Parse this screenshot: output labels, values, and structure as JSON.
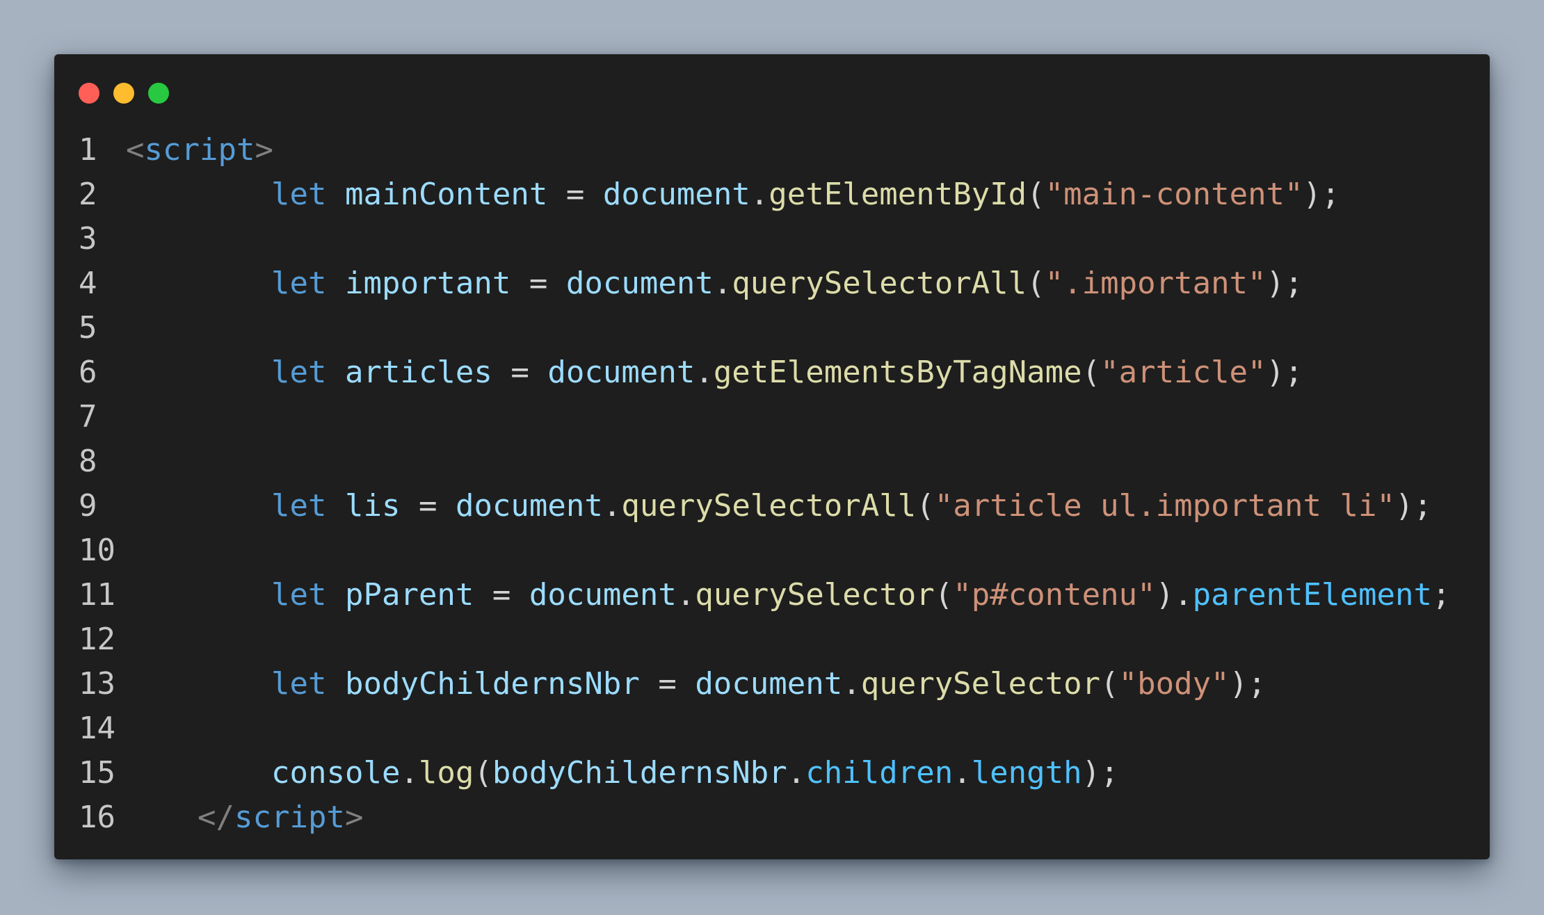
{
  "window_controls": {
    "colors": [
      "#ff5f57",
      "#febc2e",
      "#28c840"
    ],
    "names": [
      "close-window-dot",
      "minimize-window-dot",
      "maximize-window-dot"
    ]
  },
  "code": {
    "lines": [
      {
        "number": "1",
        "indent": 0,
        "tokens": [
          [
            "<",
            "#808080"
          ],
          [
            "script",
            "#569cd6"
          ],
          [
            ">",
            "#808080"
          ]
        ]
      },
      {
        "number": "2",
        "indent": 1,
        "tokens": [
          [
            "let",
            "#569cd6"
          ],
          [
            " ",
            "#d4d4d4"
          ],
          [
            "mainContent",
            "#9cdcfe"
          ],
          [
            " = ",
            "#d4d4d4"
          ],
          [
            "document",
            "#9cdcfe"
          ],
          [
            ".",
            "#d4d4d4"
          ],
          [
            "getElementById",
            "#dcdcaa"
          ],
          [
            "(",
            "#d4d4d4"
          ],
          [
            "\"main-content\"",
            "#ce9178"
          ],
          [
            ");",
            "#d4d4d4"
          ]
        ]
      },
      {
        "number": "3",
        "indent": 0,
        "tokens": []
      },
      {
        "number": "4",
        "indent": 1,
        "tokens": [
          [
            "let",
            "#569cd6"
          ],
          [
            " ",
            "#d4d4d4"
          ],
          [
            "important",
            "#9cdcfe"
          ],
          [
            " = ",
            "#d4d4d4"
          ],
          [
            "document",
            "#9cdcfe"
          ],
          [
            ".",
            "#d4d4d4"
          ],
          [
            "querySelectorAll",
            "#dcdcaa"
          ],
          [
            "(",
            "#d4d4d4"
          ],
          [
            "\".important\"",
            "#ce9178"
          ],
          [
            ");",
            "#d4d4d4"
          ]
        ]
      },
      {
        "number": "5",
        "indent": 0,
        "tokens": []
      },
      {
        "number": "6",
        "indent": 1,
        "tokens": [
          [
            "let",
            "#569cd6"
          ],
          [
            " ",
            "#d4d4d4"
          ],
          [
            "articles",
            "#9cdcfe"
          ],
          [
            " = ",
            "#d4d4d4"
          ],
          [
            "document",
            "#9cdcfe"
          ],
          [
            ".",
            "#d4d4d4"
          ],
          [
            "getElementsByTagName",
            "#dcdcaa"
          ],
          [
            "(",
            "#d4d4d4"
          ],
          [
            "\"article\"",
            "#ce9178"
          ],
          [
            ");",
            "#d4d4d4"
          ]
        ]
      },
      {
        "number": "7",
        "indent": 0,
        "tokens": []
      },
      {
        "number": "8",
        "indent": 0,
        "tokens": []
      },
      {
        "number": "9",
        "indent": 1,
        "tokens": [
          [
            "let",
            "#569cd6"
          ],
          [
            " ",
            "#d4d4d4"
          ],
          [
            "lis",
            "#9cdcfe"
          ],
          [
            " = ",
            "#d4d4d4"
          ],
          [
            "document",
            "#9cdcfe"
          ],
          [
            ".",
            "#d4d4d4"
          ],
          [
            "querySelectorAll",
            "#dcdcaa"
          ],
          [
            "(",
            "#d4d4d4"
          ],
          [
            "\"article ul.important li\"",
            "#ce9178"
          ],
          [
            ");",
            "#d4d4d4"
          ]
        ]
      },
      {
        "number": "10",
        "indent": 0,
        "tokens": []
      },
      {
        "number": "11",
        "indent": 1,
        "tokens": [
          [
            "let",
            "#569cd6"
          ],
          [
            " ",
            "#d4d4d4"
          ],
          [
            "pParent",
            "#9cdcfe"
          ],
          [
            " = ",
            "#d4d4d4"
          ],
          [
            "document",
            "#9cdcfe"
          ],
          [
            ".",
            "#d4d4d4"
          ],
          [
            "querySelector",
            "#dcdcaa"
          ],
          [
            "(",
            "#d4d4d4"
          ],
          [
            "\"p#contenu\"",
            "#ce9178"
          ],
          [
            ").",
            "#d4d4d4"
          ],
          [
            "parentElement",
            "#4fc1ff"
          ],
          [
            ";",
            "#d4d4d4"
          ]
        ]
      },
      {
        "number": "12",
        "indent": 0,
        "tokens": []
      },
      {
        "number": "13",
        "indent": 1,
        "tokens": [
          [
            "let",
            "#569cd6"
          ],
          [
            " ",
            "#d4d4d4"
          ],
          [
            "bodyChildernsNbr",
            "#9cdcfe"
          ],
          [
            " = ",
            "#d4d4d4"
          ],
          [
            "document",
            "#9cdcfe"
          ],
          [
            ".",
            "#d4d4d4"
          ],
          [
            "querySelector",
            "#dcdcaa"
          ],
          [
            "(",
            "#d4d4d4"
          ],
          [
            "\"body\"",
            "#ce9178"
          ],
          [
            ");",
            "#d4d4d4"
          ]
        ]
      },
      {
        "number": "14",
        "indent": 0,
        "tokens": []
      },
      {
        "number": "15",
        "indent": 1,
        "tokens": [
          [
            "console",
            "#9cdcfe"
          ],
          [
            ".",
            "#d4d4d4"
          ],
          [
            "log",
            "#dcdcaa"
          ],
          [
            "(",
            "#d4d4d4"
          ],
          [
            "bodyChildernsNbr",
            "#9cdcfe"
          ],
          [
            ".",
            "#d4d4d4"
          ],
          [
            "children",
            "#4fc1ff"
          ],
          [
            ".",
            "#d4d4d4"
          ],
          [
            "length",
            "#4fc1ff"
          ],
          [
            ");",
            "#d4d4d4"
          ]
        ]
      },
      {
        "number": "16",
        "indent": 2,
        "tokens": [
          [
            "</",
            "#808080"
          ],
          [
            "script",
            "#569cd6"
          ],
          [
            ">",
            "#808080"
          ]
        ]
      }
    ]
  }
}
